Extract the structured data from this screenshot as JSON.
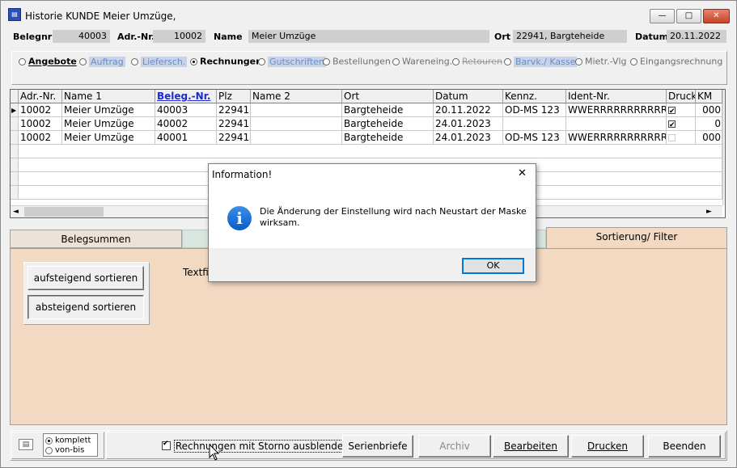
{
  "window": {
    "title": "Historie KUNDE Meier Umzüge,",
    "minimize": "—",
    "maximize": "□",
    "close": "✕"
  },
  "header": {
    "belegnr_label": "Belegnr",
    "belegnr_value": "40003",
    "adrnr_label": "Adr.-Nr.",
    "adrnr_value": "10002",
    "name_label": "Name",
    "name_value": "Meier Umzüge",
    "ort_label": "Ort",
    "ort_value": "22941, Bargteheide",
    "datum_label": "Datum",
    "datum_value": "20.11.2022"
  },
  "doc_types": [
    {
      "label": "Angebote",
      "selected": false
    },
    {
      "label": "Auftrag",
      "selected": false
    },
    {
      "label": "Liefersch.",
      "selected": false
    },
    {
      "label": "Rechnungen",
      "selected": true
    },
    {
      "label": "Gutschriften",
      "selected": false
    },
    {
      "label": "Bestellungen",
      "selected": false
    },
    {
      "label": "Wareneing.",
      "selected": false
    },
    {
      "label": "Retouren",
      "selected": false
    },
    {
      "label": "Barvk./ Kasse",
      "selected": false
    },
    {
      "label": "Mietr.-Vlg",
      "selected": false
    },
    {
      "label": "Eingangsrechnung",
      "selected": false
    }
  ],
  "grid": {
    "columns": [
      "Adr.-Nr.",
      "Name 1",
      "Beleg.-Nr.",
      "Plz",
      "Name 2",
      "Ort",
      "Datum",
      "Kennz.",
      "Ident-Nr.",
      "Druck",
      "KM"
    ],
    "rows": [
      {
        "adr": "10002",
        "name1": "Meier Umzüge",
        "beleg": "40003",
        "plz": "22941",
        "name2": "",
        "ort": "Bargteheide",
        "datum": "20.11.2022",
        "kennz": "OD-MS 123",
        "ident": "WWERRRRRRRRRRR",
        "druck": true,
        "km": "000"
      },
      {
        "adr": "10002",
        "name1": "Meier Umzüge",
        "beleg": "40002",
        "plz": "22941",
        "name2": "",
        "ort": "Bargteheide",
        "datum": "24.01.2023",
        "kennz": "",
        "ident": "",
        "druck": true,
        "km": "0"
      },
      {
        "adr": "10002",
        "name1": "Meier Umzüge",
        "beleg": "40001",
        "plz": "22941",
        "name2": "",
        "ort": "Bargteheide",
        "datum": "24.01.2023",
        "kennz": "OD-MS 123",
        "ident": "WWERRRRRRRRRRR",
        "druck": false,
        "km": "000"
      }
    ],
    "scroll_left": "◄",
    "scroll_right": "►",
    "scroll_down": "▼"
  },
  "tabs": {
    "left": "Belegsummen",
    "right": "Sortierung/ Filter"
  },
  "panel": {
    "asc_button": "aufsteigend sortieren",
    "desc_button": "absteigend sortieren",
    "textfilter_label": "Textfilt"
  },
  "dialog": {
    "title": "Information!",
    "message": "Die Änderung der Einstellung wird nach Neustart der Maske wirksam.",
    "ok": "OK",
    "close": "✕",
    "icon": "i"
  },
  "footer": {
    "komplett": "komplett",
    "vonbis": "von-bis",
    "storno_checkbox": "Rechnungen mit Storno ausblenden",
    "storno_checked": true,
    "serienbriefe": "Serienbriefe",
    "archiv": "Archiv",
    "bearbeiten": "Bearbeiten",
    "drucken": "Drucken",
    "beenden": "Beenden"
  }
}
